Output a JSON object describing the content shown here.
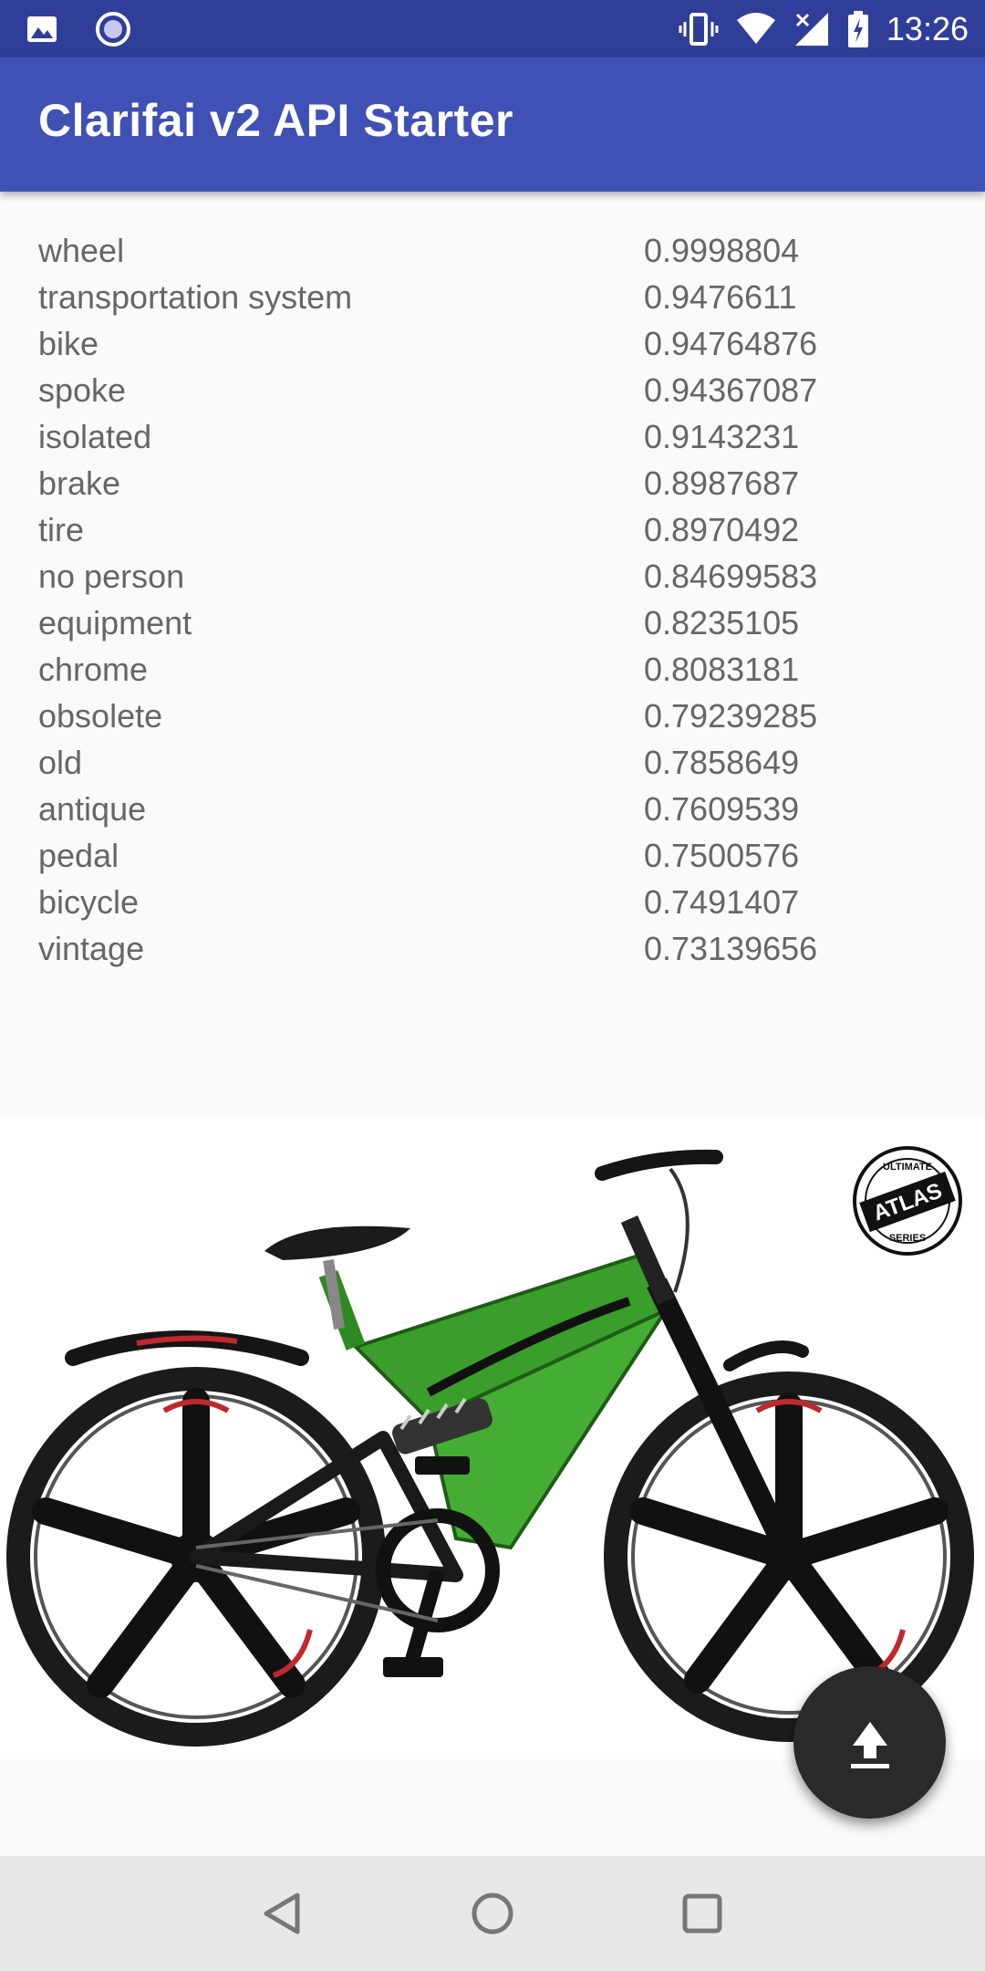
{
  "status_bar": {
    "time": "13:26",
    "left_icons": [
      "image-icon",
      "screen-record-icon"
    ],
    "right_icons": [
      "vibrate-icon",
      "wifi-icon",
      "signal-off-icon",
      "battery-icon"
    ]
  },
  "app_bar": {
    "title": "Clarifai v2 API Starter"
  },
  "results": [
    {
      "label": "wheel",
      "score": "0.9998804"
    },
    {
      "label": "transportation system",
      "score": "0.9476611"
    },
    {
      "label": "bike",
      "score": "0.94764876"
    },
    {
      "label": "spoke",
      "score": "0.94367087"
    },
    {
      "label": "isolated",
      "score": "0.9143231"
    },
    {
      "label": "brake",
      "score": "0.8987687"
    },
    {
      "label": "tire",
      "score": "0.8970492"
    },
    {
      "label": "no person",
      "score": "0.84699583"
    },
    {
      "label": "equipment",
      "score": "0.8235105"
    },
    {
      "label": "chrome",
      "score": "0.8083181"
    },
    {
      "label": "obsolete",
      "score": "0.79239285"
    },
    {
      "label": "old",
      "score": "0.7858649"
    },
    {
      "label": "antique",
      "score": "0.7609539"
    },
    {
      "label": "pedal",
      "score": "0.7500576"
    },
    {
      "label": "bicycle",
      "score": "0.7491407"
    },
    {
      "label": "vintage",
      "score": "0.73139656"
    }
  ],
  "photo": {
    "subject": "bicycle-photo",
    "logo_text": [
      "ULTIMATE",
      "ATLAS",
      "SERIES"
    ],
    "frame_color": "#3a9e2a"
  },
  "fab": {
    "icon": "upload-icon"
  },
  "nav_bar": {
    "icons": [
      "back-icon",
      "home-icon",
      "recents-icon"
    ]
  },
  "colors": {
    "status_bar": "#2f3f99",
    "app_bar": "#3f51b5",
    "text": "#666666",
    "fab": "#2a2a2a"
  }
}
